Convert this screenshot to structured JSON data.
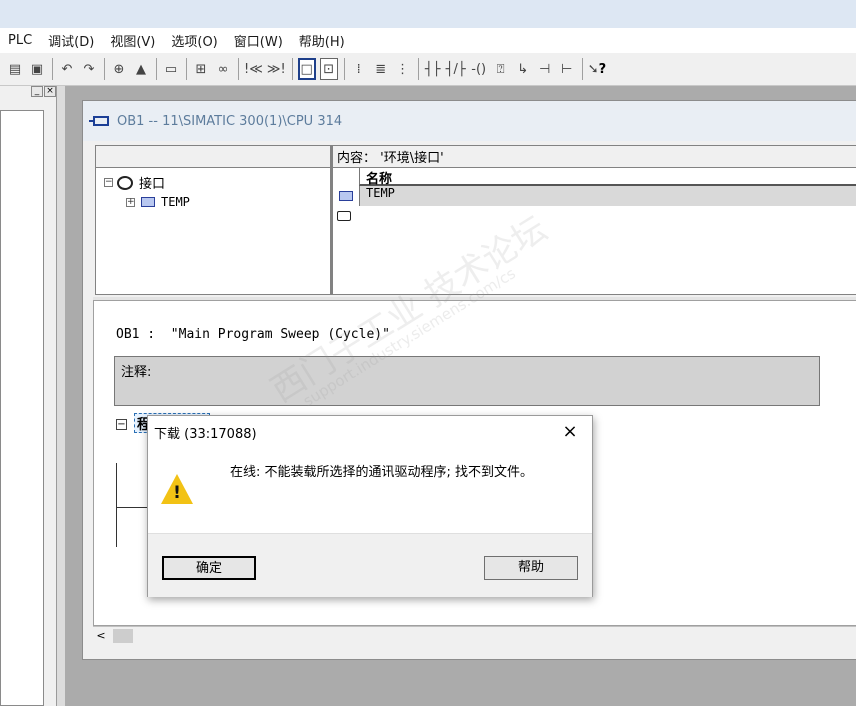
{
  "menu": [
    "PLC",
    "调试(D)",
    "视图(V)",
    "选项(O)",
    "窗口(W)",
    "帮助(H)"
  ],
  "toolbar": {
    "nav_first": "!≪",
    "nav_last": "≫!",
    "help_ctx": "?"
  },
  "left_panel": {
    "close_glyph": "×",
    "min_glyph": "_"
  },
  "window": {
    "title": "OB1 -- 11\\SIMATIC 300(1)\\CPU 314"
  },
  "interface": {
    "tree_root": "接口",
    "tree_child": "TEMP",
    "content_label": "内容：  '环境\\接口'",
    "column_name": "名称",
    "rows": [
      "TEMP"
    ]
  },
  "code": {
    "block_header": "OB1 :  \"Main Program Sweep (Cycle)\"",
    "comment_label": "注释:",
    "network_label": "程序"
  },
  "dialog": {
    "title": "下载 (33:17088)",
    "message": "在线: 不能装载所选择的通讯驱动程序; 找不到文件。",
    "ok_label": "确定",
    "help_label": "帮助",
    "close_glyph": "×"
  },
  "watermark": {
    "text": "西门子工业  技术论坛",
    "url": "support.industry.siemens.com/cs"
  },
  "colors": {
    "accent": "#1e3f8a",
    "warning": "#f2c215",
    "title_text": "#5d7c9c"
  }
}
